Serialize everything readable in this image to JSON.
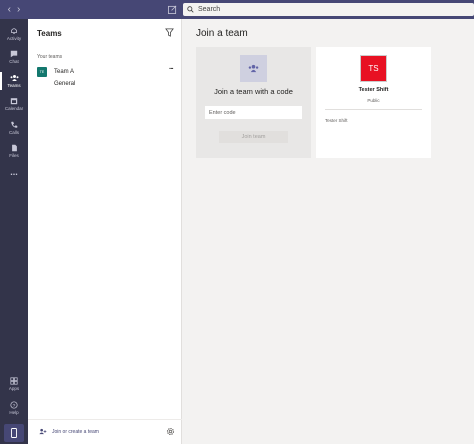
{
  "search": {
    "placeholder": "Search"
  },
  "appbar": {
    "items": [
      {
        "label": "Activity",
        "icon": "bell-icon"
      },
      {
        "label": "Chat",
        "icon": "chat-icon"
      },
      {
        "label": "Teams",
        "icon": "teams-icon"
      },
      {
        "label": "Calendar",
        "icon": "calendar-icon"
      },
      {
        "label": "Calls",
        "icon": "phone-icon"
      },
      {
        "label": "Files",
        "icon": "file-icon"
      },
      {
        "label": "...",
        "icon": "more-icon"
      },
      {
        "label": "Apps",
        "icon": "apps-icon"
      },
      {
        "label": "Help",
        "icon": "help-icon"
      }
    ]
  },
  "panel": {
    "title": "Teams",
    "section_label": "Your teams",
    "team": {
      "avatar": "TE",
      "name": "Team A",
      "channel": "General"
    },
    "join_create_label": "Join or create a team"
  },
  "main": {
    "title": "Join a team",
    "code_card": {
      "heading": "Join a team with a code",
      "input_placeholder": "Enter code",
      "join_label": "Join team"
    },
    "team_card": {
      "avatar": "TS",
      "name": "Tester Shift",
      "privacy": "Public",
      "owner": "Tester Shift"
    }
  },
  "colors": {
    "titlebar": "#464775",
    "appbar": "#33344a",
    "team_tile": "#e81123",
    "team_avatar": "#13786e"
  }
}
